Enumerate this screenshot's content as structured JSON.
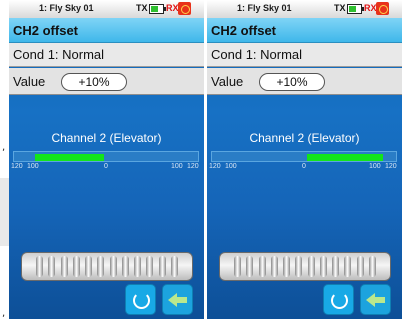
{
  "decor": {
    "comma": ","
  },
  "screens": [
    {
      "status": {
        "model": "1: Fly Sky 01",
        "tx": "TX",
        "rx": "RX"
      },
      "title": "CH2 offset",
      "condition": "Cond 1: Normal",
      "value_label": "Value",
      "value": "+10%",
      "channel_name": "Channel 2 (Elevator)",
      "bar_ticks": [
        "120",
        "100",
        "0",
        "100",
        "120"
      ],
      "bar_range": [
        -120,
        120
      ],
      "bar_fill": [
        -100,
        0
      ]
    },
    {
      "status": {
        "model": "1: Fly Sky 01",
        "tx": "TX",
        "rx": "RX"
      },
      "title": "CH2 offset",
      "condition": "Cond 1: Normal",
      "value_label": "Value",
      "value": "+10%",
      "channel_name": "Channel 2 (Elevator)",
      "bar_ticks": [
        "120",
        "100",
        "0",
        "100",
        "120"
      ],
      "bar_range": [
        -120,
        120
      ],
      "bar_fill": [
        0,
        100
      ]
    }
  ],
  "colors": {
    "title_bar": "#3fb7ea",
    "bar_fill": "#13e51a",
    "rx_red": "#e01010",
    "background": "#1565b8"
  },
  "icons": [
    "battery-icon",
    "rx-signal-icon",
    "undo-icon",
    "back-arrow-icon"
  ]
}
